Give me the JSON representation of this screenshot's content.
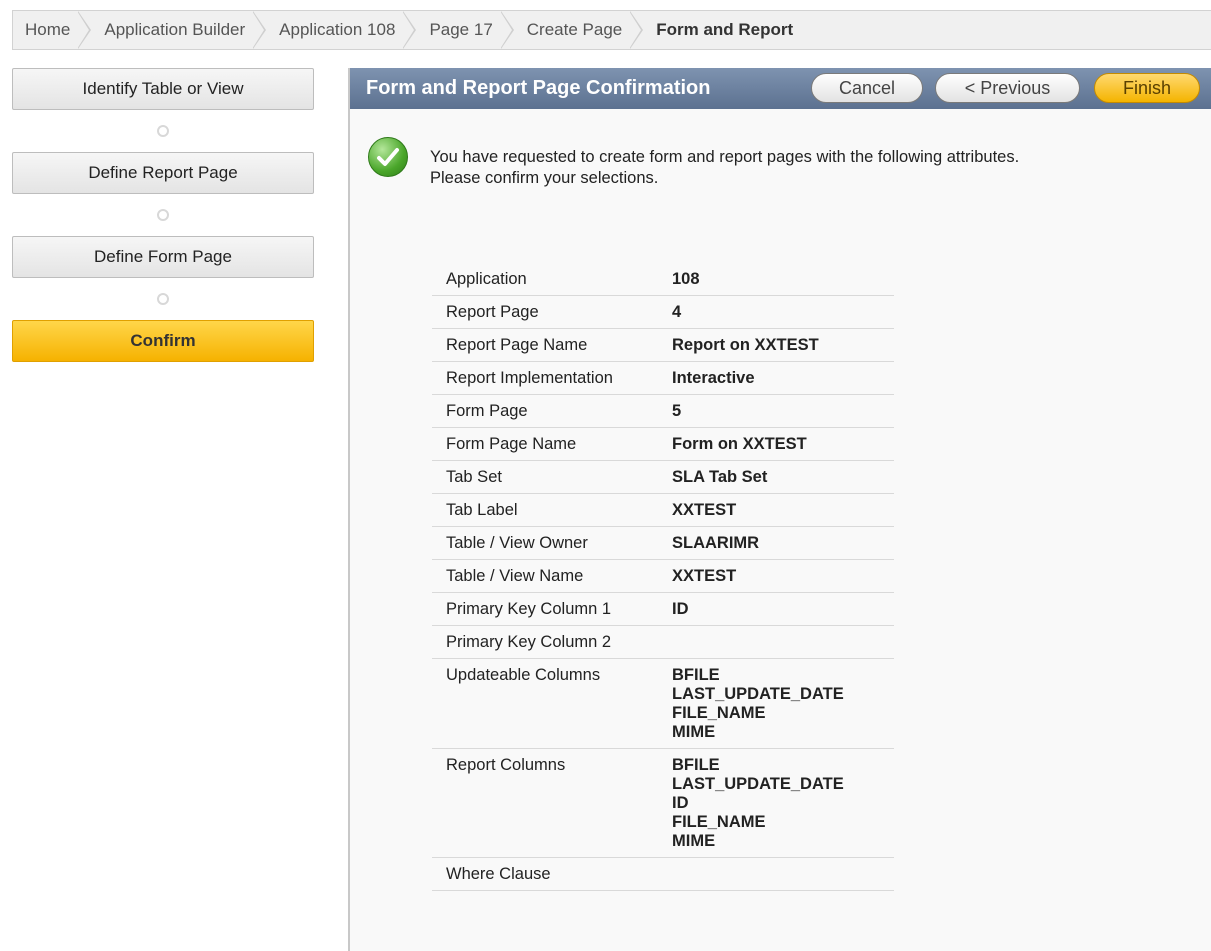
{
  "breadcrumb": [
    {
      "label": "Home"
    },
    {
      "label": "Application Builder"
    },
    {
      "label": "Application 108"
    },
    {
      "label": "Page 17"
    },
    {
      "label": "Create Page"
    },
    {
      "label": "Form and Report"
    }
  ],
  "wizard": {
    "steps": [
      {
        "label": "Identify Table or View"
      },
      {
        "label": "Define Report Page"
      },
      {
        "label": "Define Form Page"
      },
      {
        "label": "Confirm"
      }
    ]
  },
  "region": {
    "title": "Form and Report Page Confirmation",
    "buttons": {
      "cancel": "Cancel",
      "previous": "< Previous",
      "finish": "Finish"
    },
    "intro_line1": "You have requested to create form and report pages with the following attributes.",
    "intro_line2": "Please confirm your selections."
  },
  "attributes": [
    {
      "key": "Application",
      "values": [
        "108"
      ]
    },
    {
      "key": "Report Page",
      "values": [
        "4"
      ]
    },
    {
      "key": "Report Page Name",
      "values": [
        "Report on XXTEST"
      ]
    },
    {
      "key": "Report Implementation",
      "values": [
        "Interactive"
      ]
    },
    {
      "key": "Form Page",
      "values": [
        "5"
      ]
    },
    {
      "key": "Form Page Name",
      "values": [
        "Form on XXTEST"
      ]
    },
    {
      "key": "Tab Set",
      "values": [
        "SLA Tab Set"
      ]
    },
    {
      "key": "Tab Label",
      "values": [
        "XXTEST"
      ]
    },
    {
      "key": "Table / View Owner",
      "values": [
        "SLAARIMR"
      ]
    },
    {
      "key": "Table / View Name",
      "values": [
        "XXTEST"
      ]
    },
    {
      "key": "Primary Key Column 1",
      "values": [
        "ID"
      ]
    },
    {
      "key": "Primary Key Column 2",
      "values": []
    },
    {
      "key": "Updateable Columns",
      "values": [
        "BFILE",
        "LAST_UPDATE_DATE",
        "FILE_NAME",
        "MIME"
      ]
    },
    {
      "key": "Report Columns",
      "values": [
        "BFILE",
        "LAST_UPDATE_DATE",
        "ID",
        "FILE_NAME",
        "MIME"
      ]
    },
    {
      "key": "Where Clause",
      "values": []
    }
  ],
  "icons": {
    "success": "check-circle-icon",
    "step_connector": "connector-dot-icon"
  },
  "colors": {
    "region_header": "#6a7f9d",
    "active_step": "#f6b200",
    "finish_button": "#f4b400"
  }
}
